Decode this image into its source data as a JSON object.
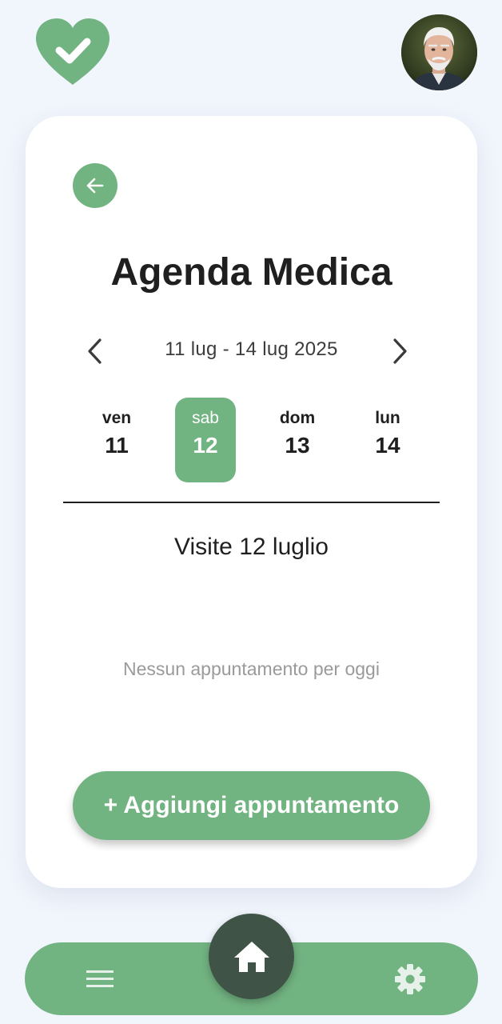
{
  "header": {
    "logo_icon": "heart-check-icon",
    "avatar_alt": "profile-photo"
  },
  "colors": {
    "accent": "#72b382",
    "dark_accent": "#3f5447",
    "background": "#f1f5fc",
    "text": "#1f1f1f",
    "muted": "#9a9a9a"
  },
  "agenda": {
    "title": "Agenda Medica",
    "range_label": "11 lug - 14 lug 2025",
    "days": [
      {
        "name": "ven",
        "number": "11",
        "selected": false
      },
      {
        "name": "sab",
        "number": "12",
        "selected": true
      },
      {
        "name": "dom",
        "number": "13",
        "selected": false
      },
      {
        "name": "lun",
        "number": "14",
        "selected": false
      }
    ],
    "visits_title": "Visite 12 luglio",
    "empty_message": "Nessun appuntamento per oggi",
    "add_button_label": "+ Aggiungi appuntamento"
  },
  "bottom_nav": {
    "items": [
      {
        "icon": "menu-icon"
      },
      {
        "icon": "home-icon"
      },
      {
        "icon": "gear-icon"
      }
    ]
  }
}
